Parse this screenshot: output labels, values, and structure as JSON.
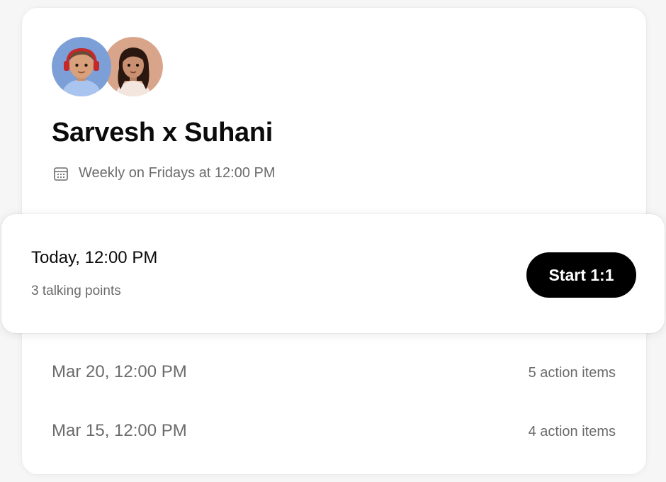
{
  "meeting": {
    "title": "Sarvesh x Suhani",
    "schedule": "Weekly on Fridays at 12:00 PM",
    "avatars": [
      {
        "person": "Sarvesh"
      },
      {
        "person": "Suhani"
      }
    ]
  },
  "upcoming": {
    "time": "Today, 12:00 PM",
    "talking_points": "3 talking points",
    "start_label": "Start 1:1"
  },
  "past": [
    {
      "date": "Mar 20, 12:00 PM",
      "action_items": "5 action items"
    },
    {
      "date": "Mar 15, 12:00 PM",
      "action_items": "4 action items"
    }
  ],
  "colors": {
    "button_bg": "#000000",
    "muted_text": "#6b6b6b",
    "avatar1_bg": "#7b9fd6",
    "avatar2_bg": "#d9a58a"
  }
}
